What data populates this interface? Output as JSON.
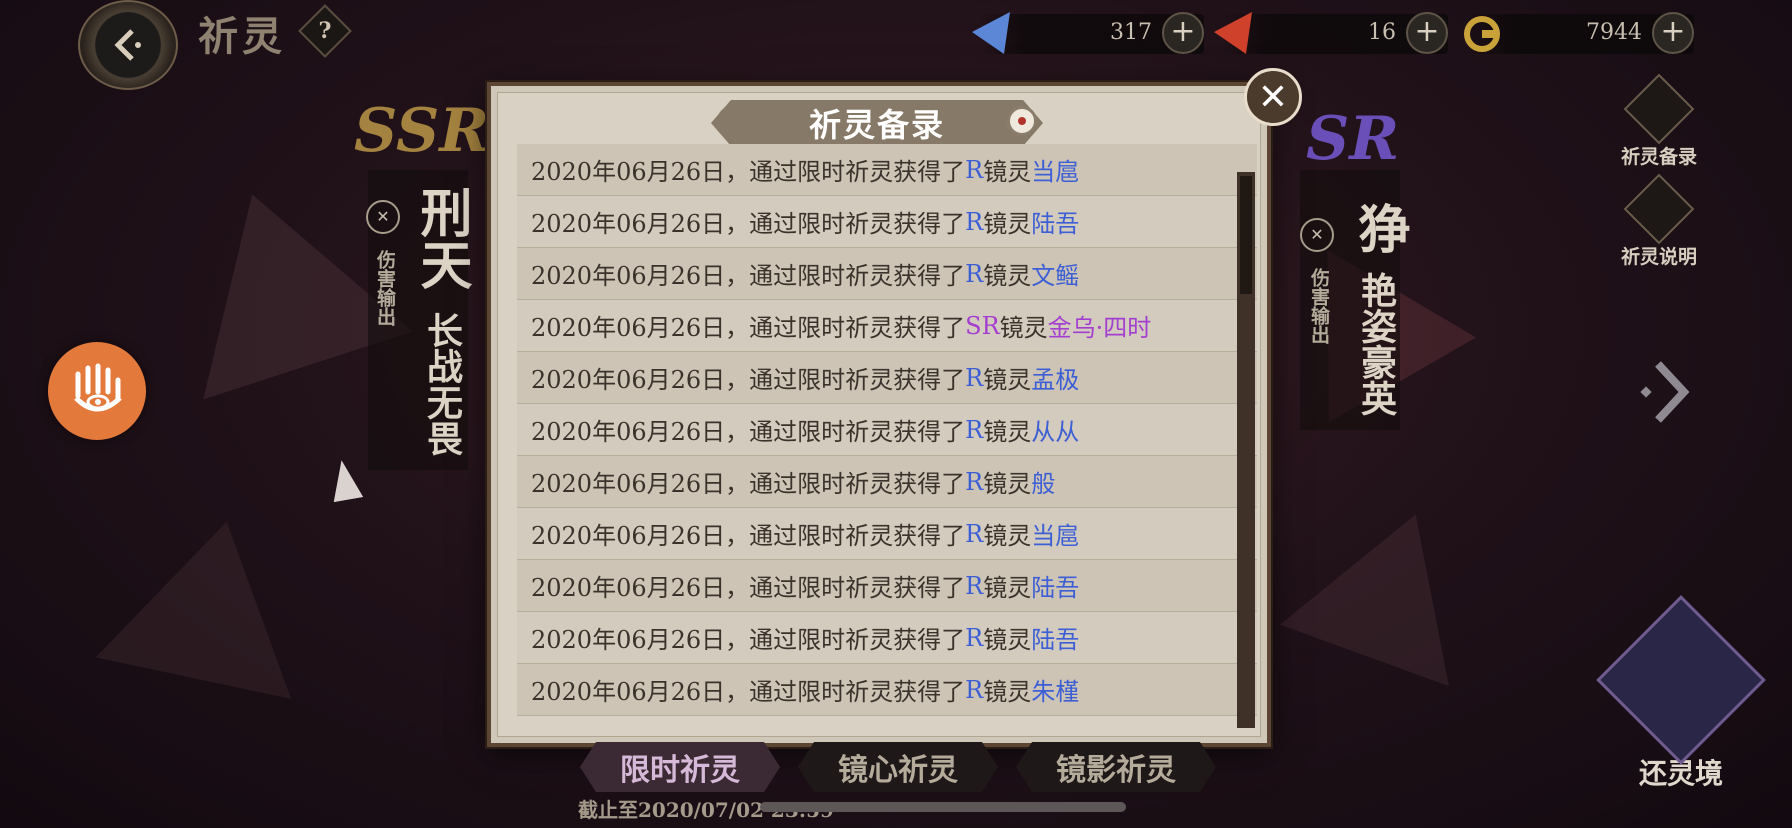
{
  "header": {
    "title": "祈灵",
    "help_icon": "?"
  },
  "currencies": [
    {
      "name": "blue-crystal",
      "value": "317",
      "color": "#5b87d6"
    },
    {
      "name": "red-crystal",
      "value": "16",
      "color": "#d0412b"
    },
    {
      "name": "gold-coin",
      "value": "7944",
      "color": "#c9a23a"
    }
  ],
  "side_buttons": {
    "records": "祈灵备录",
    "info": "祈灵说明"
  },
  "left_card": {
    "rank": "SSR",
    "name": "刑天",
    "subtitle": "长战无畏",
    "role": "伤害输出"
  },
  "right_card": {
    "rank": "SR",
    "name": "狰",
    "subtitle": "艳姿豪英",
    "role": "伤害输出"
  },
  "modal": {
    "title": "祈灵备录",
    "close_icon": "✕",
    "rows": [
      {
        "prefix": "2020年06月26日，通过限时祈灵获得了",
        "rank": "R",
        "kind": "镜灵",
        "name": "当扈",
        "rarity": "R"
      },
      {
        "prefix": "2020年06月26日，通过限时祈灵获得了",
        "rank": "R",
        "kind": "镜灵",
        "name": "陆吾",
        "rarity": "R"
      },
      {
        "prefix": "2020年06月26日，通过限时祈灵获得了",
        "rank": "R",
        "kind": "镜灵",
        "name": "文鳐",
        "rarity": "R"
      },
      {
        "prefix": "2020年06月26日，通过限时祈灵获得了",
        "rank": "SR",
        "kind": "镜灵",
        "name": "金乌·四时",
        "rarity": "SR"
      },
      {
        "prefix": "2020年06月26日，通过限时祈灵获得了",
        "rank": "R",
        "kind": "镜灵",
        "name": "孟极",
        "rarity": "R"
      },
      {
        "prefix": "2020年06月26日，通过限时祈灵获得了",
        "rank": "R",
        "kind": "镜灵",
        "name": "从从",
        "rarity": "R"
      },
      {
        "prefix": "2020年06月26日，通过限时祈灵获得了",
        "rank": "R",
        "kind": "镜灵",
        "name": "般",
        "rarity": "R"
      },
      {
        "prefix": "2020年06月26日，通过限时祈灵获得了",
        "rank": "R",
        "kind": "镜灵",
        "name": "当扈",
        "rarity": "R"
      },
      {
        "prefix": "2020年06月26日，通过限时祈灵获得了",
        "rank": "R",
        "kind": "镜灵",
        "name": "陆吾",
        "rarity": "R"
      },
      {
        "prefix": "2020年06月26日，通过限时祈灵获得了",
        "rank": "R",
        "kind": "镜灵",
        "name": "陆吾",
        "rarity": "R"
      },
      {
        "prefix": "2020年06月26日，通过限时祈灵获得了",
        "rank": "R",
        "kind": "镜灵",
        "name": "朱槿",
        "rarity": "R"
      }
    ]
  },
  "tabs": [
    "限时祈灵",
    "镜心祈灵",
    "镜影祈灵"
  ],
  "active_tab": "限时祈灵",
  "deadline": "截止至2020/07/02 23:59",
  "return_button": "还灵境",
  "colors": {
    "rank_r": "#3d5fd6",
    "rank_sr": "#a43ed0",
    "accent_orange": "#e3793b"
  }
}
